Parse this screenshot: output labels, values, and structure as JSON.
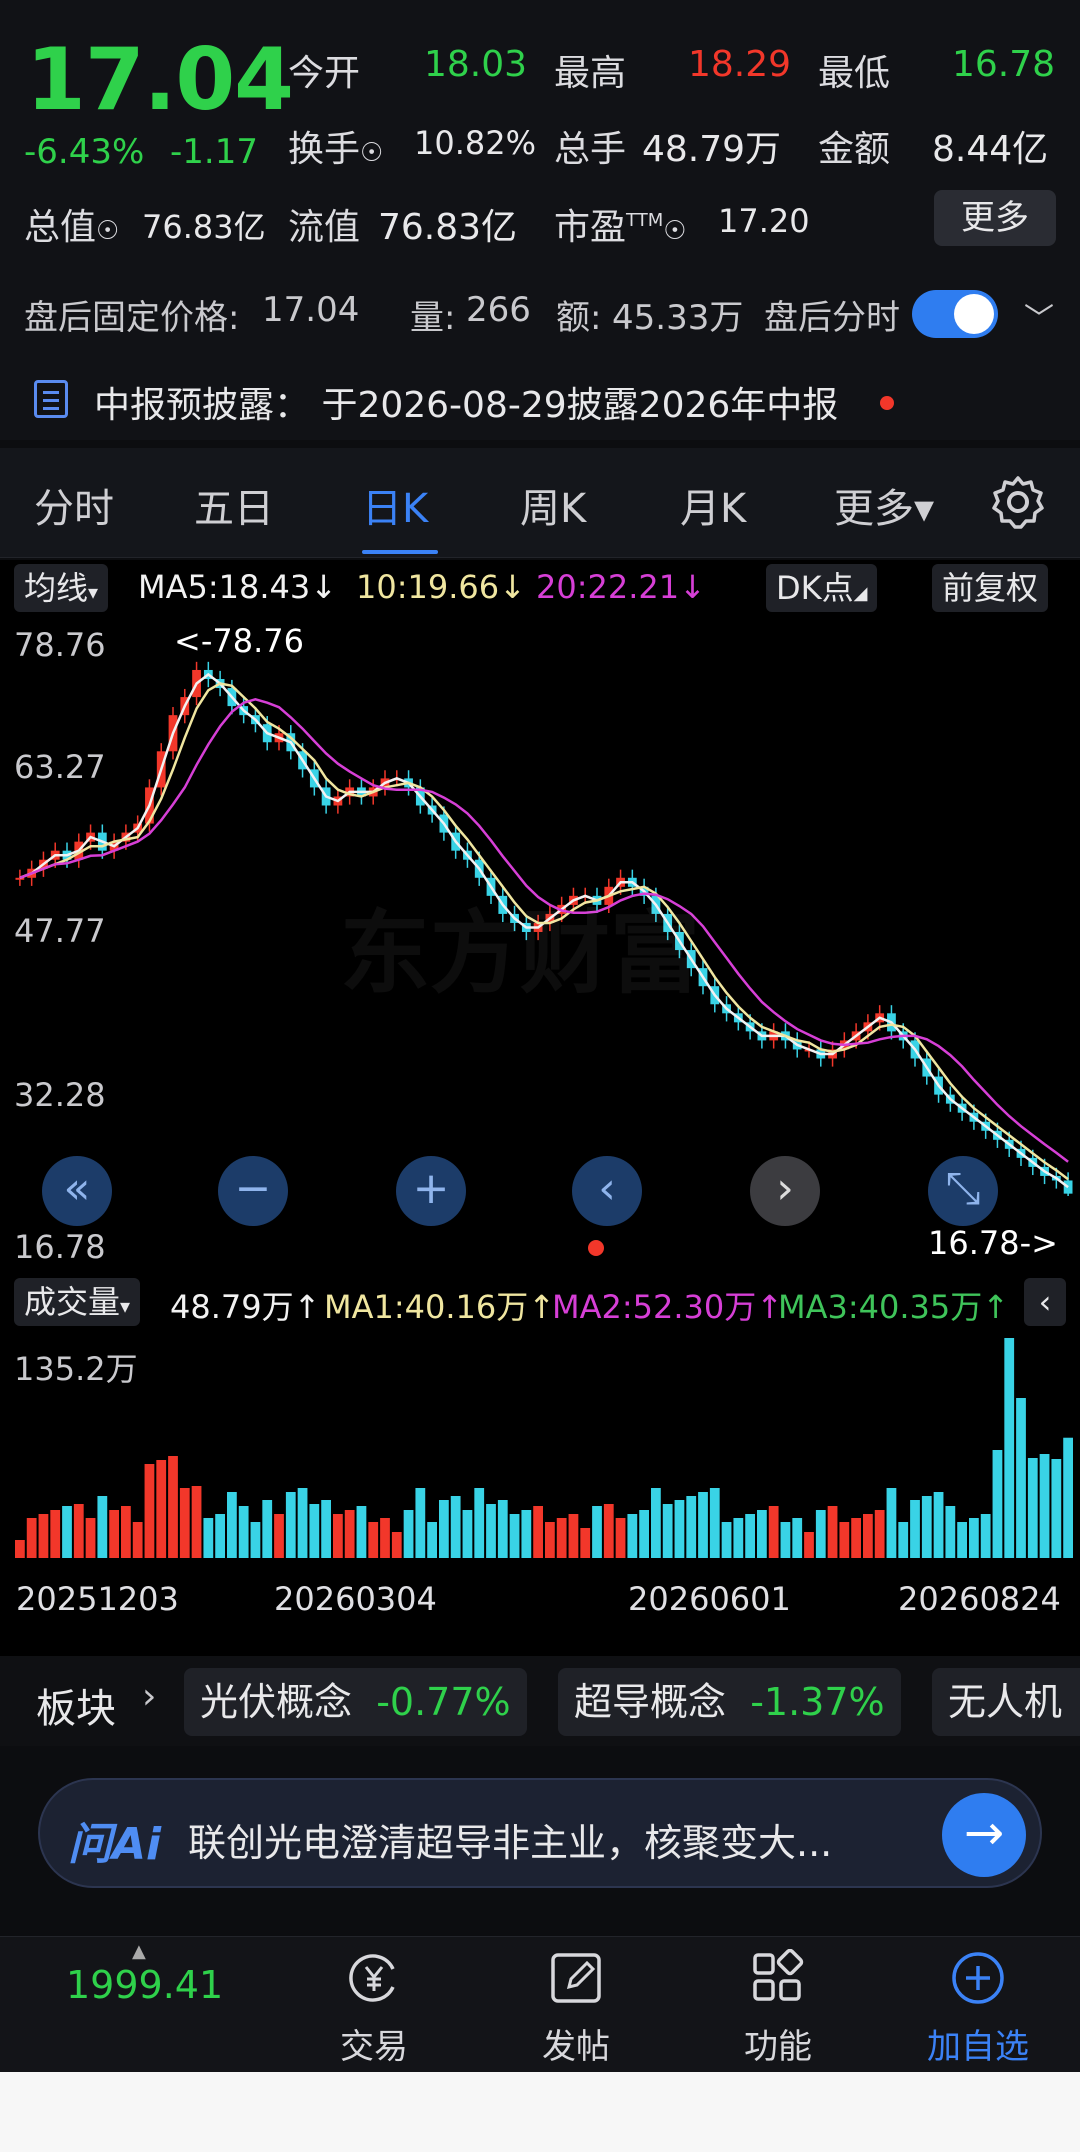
{
  "quote": {
    "price": "17.04",
    "change_pct": "-6.43%",
    "change": "-1.17",
    "open_label": "今开",
    "open": "18.03",
    "high_label": "最高",
    "high": "18.29",
    "low_label": "最低",
    "low": "16.78",
    "turnover_label": "换手",
    "turnover": "10.82%",
    "volume_label": "总手",
    "volume": "48.79万",
    "amount_label": "金额",
    "amount": "8.44亿",
    "mktcap_label": "总值",
    "mktcap": "76.83亿",
    "float_label": "流值",
    "float_cap": "76.83亿",
    "pe_label": "市盈",
    "pe_sup": "TTM",
    "pe": "17.20",
    "more_label": "更多"
  },
  "after_hours": {
    "price_label": "盘后固定价格:",
    "price": "17.04",
    "vol_label": "量:",
    "vol": "266",
    "amt_label": "额:",
    "amt": "45.33万",
    "toggle_label": "盘后分时",
    "toggle_on": true
  },
  "notice": {
    "text": "中报预披露：  于2026-08-29披露2026年中报"
  },
  "tabs": [
    {
      "label": "分时"
    },
    {
      "label": "五日"
    },
    {
      "label": "日K",
      "active": true
    },
    {
      "label": "周K"
    },
    {
      "label": "月K"
    },
    {
      "label": "更多▾"
    }
  ],
  "kline": {
    "ma_select": "均线",
    "ma5": "MA5:18.43↓",
    "ma10": "10:19.66↓",
    "ma20": "20:22.21↓",
    "dk_label": "DK点",
    "adjust_label": "前复权",
    "axis_labels": [
      "78.76",
      "63.27",
      "47.77",
      "32.28",
      "16.78"
    ],
    "max_marker": "<-78.76",
    "min_marker": "16.78->",
    "watermark": "东方财富",
    "colors": {
      "ma5": "#f2f2f2",
      "ma10": "#f0e6a0",
      "ma20": "#d63fd6",
      "up": "#f2372a",
      "down": "#39d3e6"
    }
  },
  "volume_panel": {
    "select_label": "成交量",
    "vol": "48.79万↑",
    "ma1": "MA1:40.16万↑",
    "ma2": "MA2:52.30万↑",
    "ma3": "MA3:40.35万↑",
    "max_label": "135.2万",
    "dates": [
      "20251203",
      "20260304",
      "20260601",
      "20260824"
    ]
  },
  "chart_data": {
    "type": "candlestick",
    "ohlc_close_approx": [
      52,
      53,
      54,
      55,
      54,
      56,
      57,
      55,
      56,
      57,
      58,
      62,
      66,
      70,
      72,
      75,
      74,
      73,
      71,
      70,
      69,
      67,
      68,
      66,
      64,
      62,
      60,
      61,
      62,
      61,
      62,
      63,
      63,
      62,
      60,
      59,
      57,
      55,
      54,
      52,
      50,
      48,
      47,
      46,
      47,
      48,
      49,
      50,
      50,
      49,
      51,
      52,
      51,
      50,
      48,
      46,
      44,
      42,
      40,
      38,
      37,
      36,
      35,
      34,
      35,
      34,
      33,
      33,
      32,
      33,
      34,
      35,
      36,
      37,
      35,
      34,
      32,
      30,
      28,
      27,
      26,
      25,
      24,
      23,
      22,
      21,
      20,
      19,
      18.5,
      17.04
    ],
    "y_axis": [
      16.78,
      78.76
    ],
    "x_dates": [
      "20251203",
      "20260304",
      "20260601",
      "20260824"
    ]
  },
  "sectors": {
    "label": "板块",
    "items": [
      {
        "name": "光伏概念",
        "change": "-0.77%"
      },
      {
        "name": "超导概念",
        "change": "-1.37%"
      },
      {
        "name": "无人机",
        "change": ""
      }
    ]
  },
  "ai": {
    "logo": "问Ai",
    "text": "联创光电澄清超导非主业，核聚变大..."
  },
  "bottom_nav": {
    "index_value": "1999.41",
    "items": [
      {
        "label": "交易",
        "icon": "yuan-icon"
      },
      {
        "label": "发帖",
        "icon": "edit-icon"
      },
      {
        "label": "功能",
        "icon": "grid-icon"
      },
      {
        "label": "加自选",
        "icon": "plus-circle-icon"
      }
    ]
  }
}
